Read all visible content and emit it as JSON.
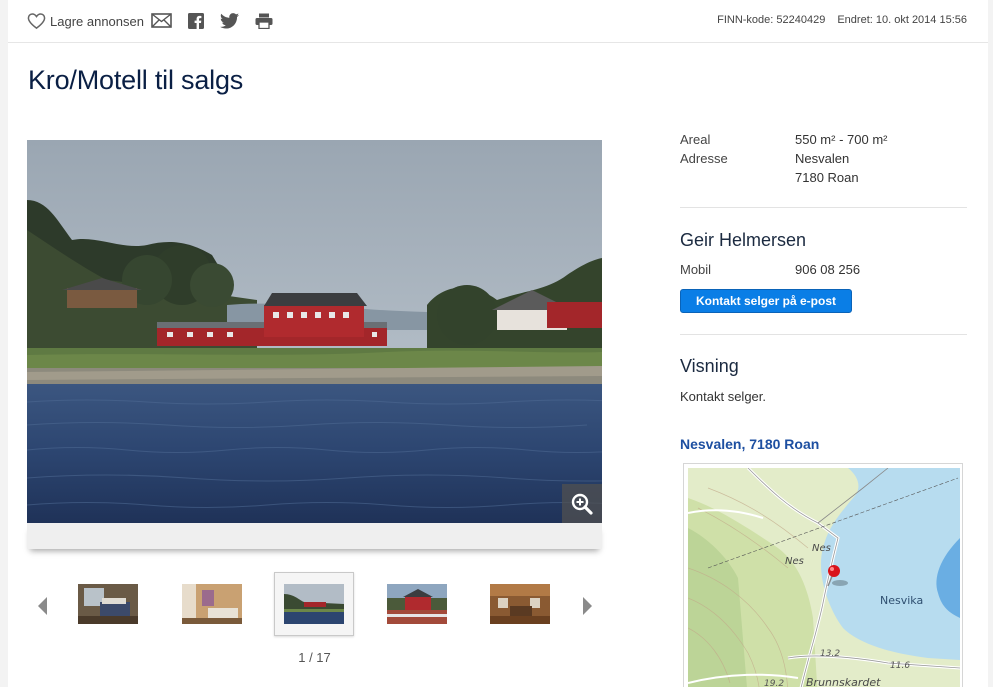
{
  "toolbar": {
    "save_label": "Lagre annonsen",
    "finn_code": "FINN-kode: 52240429",
    "updated": "Endret: 10. okt 2014 15:56"
  },
  "listing": {
    "title": "Kro/Motell til salgs"
  },
  "gallery": {
    "counter": "1 / 17",
    "current": 1,
    "total": 17
  },
  "facts": {
    "area_label": "Areal",
    "area_value": "550 m² - 700 m²",
    "address_label": "Adresse",
    "address_line1": "Nesvalen",
    "address_line2": "7180 Roan"
  },
  "contact": {
    "name": "Geir Helmersen",
    "mobile_label": "Mobil",
    "mobile_value": "906 08 256",
    "email_button": "Kontakt selger på e-post"
  },
  "viewing": {
    "heading": "Visning",
    "text": "Kontakt selger."
  },
  "map": {
    "address_link": "Nesvalen, 7180 Roan",
    "labels": {
      "nes_top": "Nes",
      "nes_bottom": "Nes",
      "nesvika": "Nesvika",
      "brunnskardet": "Brunnskardet",
      "elev_a": "13.2",
      "elev_b": "11.6",
      "elev_c": "19.2"
    }
  },
  "colors": {
    "primary_button": "#0a7ee6",
    "link": "#1d4fa1",
    "title": "#0a1f44",
    "map_pin": "#d9141b"
  }
}
